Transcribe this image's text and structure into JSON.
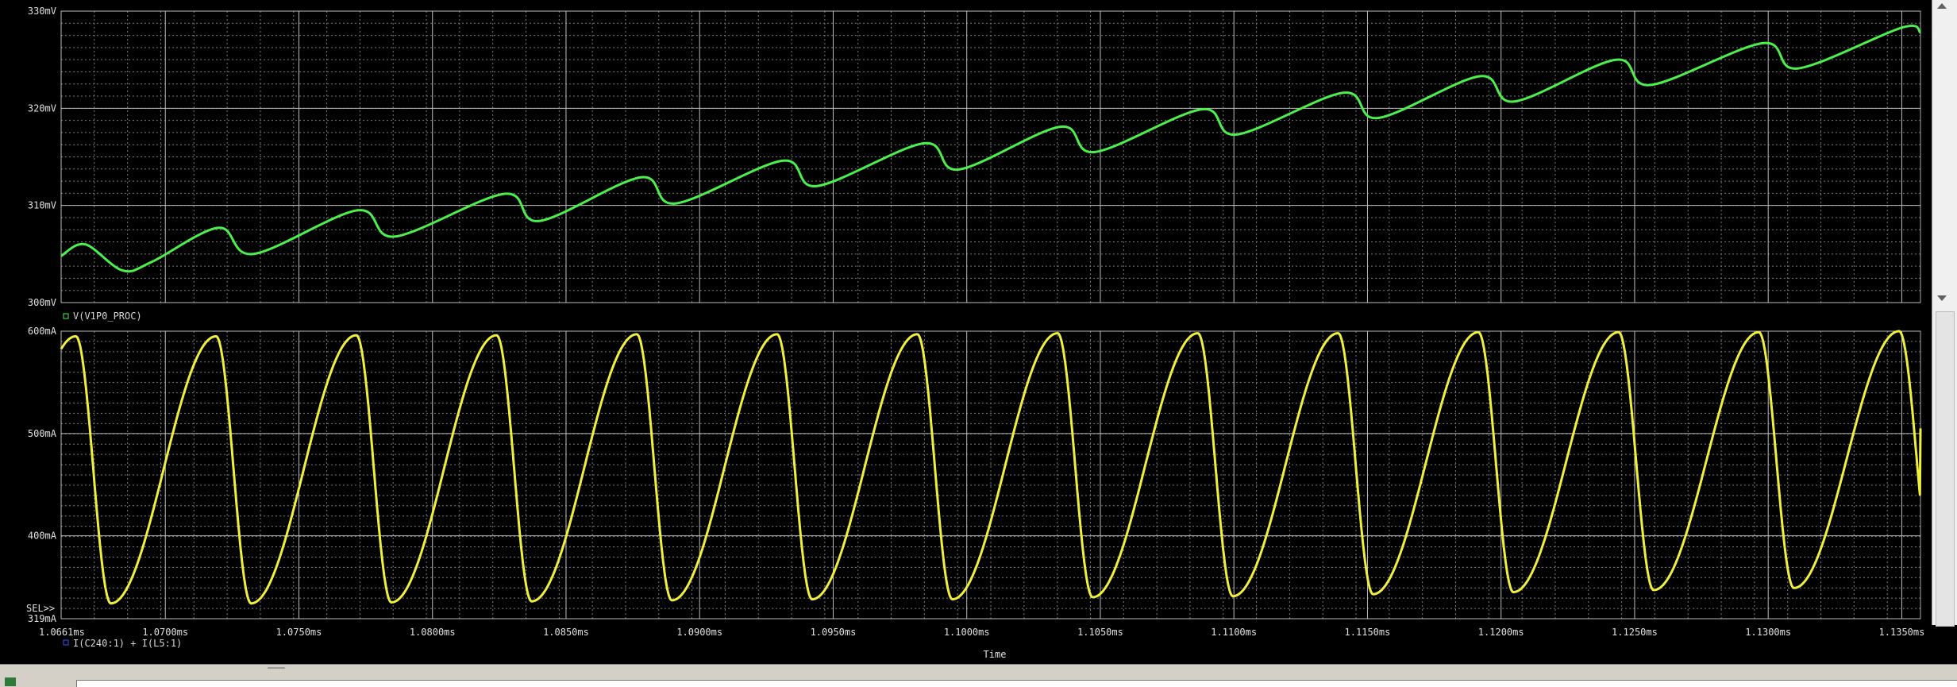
{
  "chart_data": [
    {
      "type": "line",
      "title": "",
      "xlabel": "Time",
      "ylabel": "",
      "xlim": [
        1.0661,
        1.1357
      ],
      "ylim": [
        300,
        330
      ],
      "x_unit": "ms",
      "y_unit": "mV",
      "y_ticks": [
        300,
        310,
        320,
        330
      ],
      "y_tick_labels": [
        "300mV",
        "310mV",
        "320mV",
        "330mV"
      ],
      "grid": true,
      "series": [
        {
          "name": "V(V1P0_PROC)",
          "color": "#4cf04c",
          "x": [
            1.0661,
            1.067,
            1.0684,
            1.0695,
            1.072,
            1.0733,
            1.0772,
            1.0786,
            1.0827,
            1.084,
            1.0878,
            1.0891,
            1.0931,
            1.0944,
            1.0984,
            1.0997,
            1.1035,
            1.1048,
            1.1088,
            1.1101,
            1.1141,
            1.1154,
            1.1192,
            1.1205,
            1.1243,
            1.1256,
            1.1298,
            1.1311,
            1.135,
            1.1357
          ],
          "values": [
            304.8,
            306.0,
            303.3,
            304.2,
            307.7,
            305.0,
            309.5,
            306.8,
            311.2,
            308.4,
            312.9,
            310.2,
            314.6,
            312.0,
            316.4,
            313.7,
            318.1,
            315.5,
            319.9,
            317.3,
            321.6,
            319.0,
            323.3,
            320.7,
            325.0,
            322.4,
            326.7,
            324.1,
            328.3,
            327.8
          ]
        }
      ],
      "legend": "bottom-left"
    },
    {
      "type": "line",
      "title": "",
      "xlabel": "Time",
      "ylabel": "",
      "xlim": [
        1.0661,
        1.1357
      ],
      "ylim": [
        319,
        600
      ],
      "x_unit": "ms",
      "y_unit": "mA",
      "y_ticks": [
        319,
        400,
        500,
        600
      ],
      "y_tick_labels": [
        "319mA",
        "400mA",
        "500mA",
        "600mA"
      ],
      "x_ticks": [
        1.0661,
        1.07,
        1.075,
        1.08,
        1.085,
        1.09,
        1.095,
        1.1,
        1.105,
        1.11,
        1.115,
        1.12,
        1.125,
        1.13,
        1.135
      ],
      "x_tick_labels": [
        "1.0661ms",
        "1.0700ms",
        "1.0750ms",
        "1.0800ms",
        "1.0850ms",
        "1.0900ms",
        "1.0950ms",
        "1.1000ms",
        "1.1050ms",
        "1.1100ms",
        "1.1150ms",
        "1.1200ms",
        "1.1250ms",
        "1.1300ms",
        "1.1350ms"
      ],
      "grid": true,
      "cursor_label": "SEL>>",
      "series": [
        {
          "name": "I(C240:1) + I(L5:1)",
          "color": "#f0f03c",
          "period_ms": 0.00525,
          "peak_first": 1.06665,
          "amplitude_high": 595,
          "amplitude_low": 334,
          "rise_fraction": 0.75,
          "peak_values": [
            595,
            595,
            596,
            596,
            597,
            597,
            597,
            598,
            598,
            598,
            599,
            599,
            599,
            600
          ],
          "trough_values": [
            334,
            334,
            335,
            336,
            337,
            338,
            338,
            340,
            341,
            343,
            345,
            347,
            349,
            352
          ],
          "end_value": 505
        }
      ],
      "legend": "bottom-left"
    }
  ]
}
